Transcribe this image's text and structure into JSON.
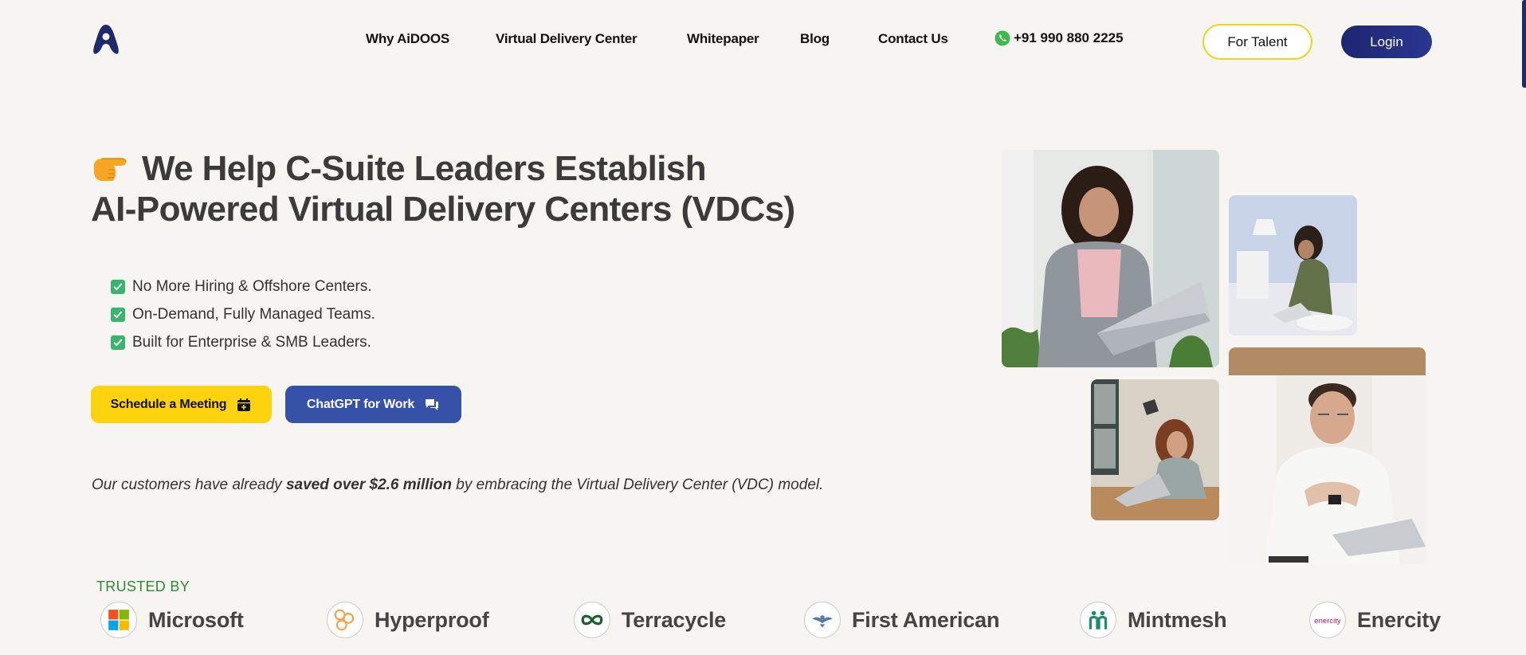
{
  "header": {
    "logo_icon": "aidoos-logo-icon",
    "nav": [
      {
        "label": "Why AiDOOS"
      },
      {
        "label": "Virtual Delivery Center"
      },
      {
        "label": "Whitepaper"
      },
      {
        "label": "Blog"
      },
      {
        "label": "Contact Us"
      }
    ],
    "phone": {
      "icon": "whatsapp-icon",
      "number": "+91 990 880 2225"
    },
    "talent_button": "For Talent",
    "login_button": "Login"
  },
  "hero": {
    "headline_line1": "We Help C-Suite Leaders Establish",
    "headline_line2": "AI-Powered Virtual Delivery Centers (VDCs)",
    "headline_icon": "pointing-hand-icon",
    "checks": [
      "No More Hiring & Offshore Centers.",
      "On-Demand, Fully Managed Teams.",
      "Built for Enterprise & SMB Leaders."
    ],
    "schedule_button": "Schedule a Meeting",
    "chatgpt_button": "ChatGPT for Work",
    "savings_prefix": "Our customers have already",
    "savings_bold": "saved over $2.6 million",
    "savings_suffix": "by embracing the Virtual Delivery Center (VDC) model."
  },
  "photos": [
    {
      "name": "woman-with-laptop-photo"
    },
    {
      "name": "woman-working-on-floor-photo"
    },
    {
      "name": "woman-at-desk-photo"
    },
    {
      "name": "smiling-man-at-laptop-photo"
    }
  ],
  "trusted": {
    "title": "TRUSTED BY",
    "brands": [
      {
        "name": "Microsoft",
        "icon": "microsoft-logo-icon"
      },
      {
        "name": "Hyperproof",
        "icon": "hyperproof-logo-icon"
      },
      {
        "name": "Terracycle",
        "icon": "terracycle-logo-icon"
      },
      {
        "name": "First American",
        "icon": "first-american-logo-icon"
      },
      {
        "name": "Mintmesh",
        "icon": "mintmesh-logo-icon"
      },
      {
        "name": "Enercity",
        "icon": "enercity-logo-icon",
        "logo_text": "enercity"
      }
    ]
  },
  "colors": {
    "background": "#f6f5f1",
    "brand_navy": "#1c2670",
    "accent_yellow": "#fdd30d",
    "accent_blue": "#3552a8",
    "check_green": "#3bb56e",
    "trusted_green": "#2e8b2e"
  }
}
